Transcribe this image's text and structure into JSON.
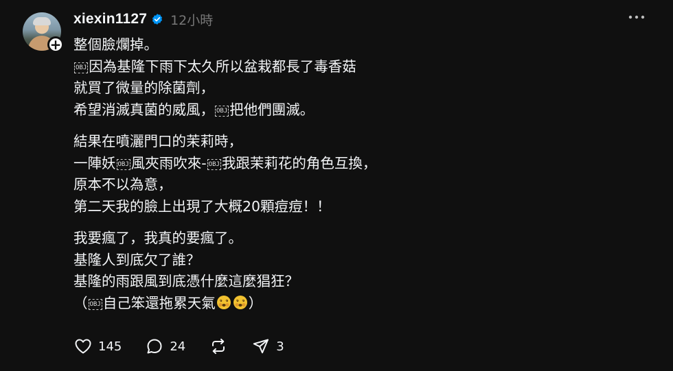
{
  "post": {
    "username": "xiexin1127",
    "time": "12小時",
    "paragraphs": [
      [
        [
          {
            "t": "整個臉爛掉。"
          }
        ],
        [
          {
            "obj": "OBJ"
          },
          {
            "t": "因為基隆下雨下太久所以盆栽都長了毒香菇"
          }
        ],
        [
          {
            "t": "就買了微量的除菌劑，"
          }
        ],
        [
          {
            "t": "希望消滅真菌的威風，"
          },
          {
            "obj": "OBJ"
          },
          {
            "t": "把他們團滅。"
          }
        ]
      ],
      [
        [
          {
            "t": "結果在噴灑門口的茉莉時，"
          }
        ],
        [
          {
            "t": "一陣妖"
          },
          {
            "obj": "OBJ"
          },
          {
            "t": "風夾雨吹來-"
          },
          {
            "obj": "OBJ"
          },
          {
            "t": "我跟茉莉花的角色互換，"
          }
        ],
        [
          {
            "t": "原本不以為意，"
          }
        ],
        [
          {
            "t": "第二天我的臉上出現了大概20顆痘痘！！"
          }
        ]
      ],
      [
        [
          {
            "t": "我要瘋了，我真的要瘋了。"
          }
        ],
        [
          {
            "t": "基隆人到底欠了誰？"
          }
        ],
        [
          {
            "t": "基隆的雨跟風到底憑什麼這麼猖狂？"
          }
        ],
        [
          {
            "t": "（"
          },
          {
            "obj": "OBJ"
          },
          {
            "t": "自己笨還拖累天氣"
          },
          {
            "emoji": "face-with-spiral-eyes"
          },
          {
            "emoji": "face-with-spiral-eyes"
          },
          {
            "t": "）"
          }
        ]
      ]
    ]
  },
  "actions": {
    "likes": "145",
    "comments": "24",
    "shares": "3"
  },
  "icons": {
    "verified": "verified-badge-icon",
    "more": "more-horizontal-icon",
    "like": "heart-icon",
    "comment": "comment-bubble-icon",
    "repost": "repost-icon",
    "share": "send-icon",
    "emoji": "face-with-spiral-eyes"
  },
  "colors": {
    "background": "#101010",
    "text": "#f3f5f7",
    "muted": "#777777",
    "verified": "#0095f6",
    "emoji": "#f2c230"
  }
}
